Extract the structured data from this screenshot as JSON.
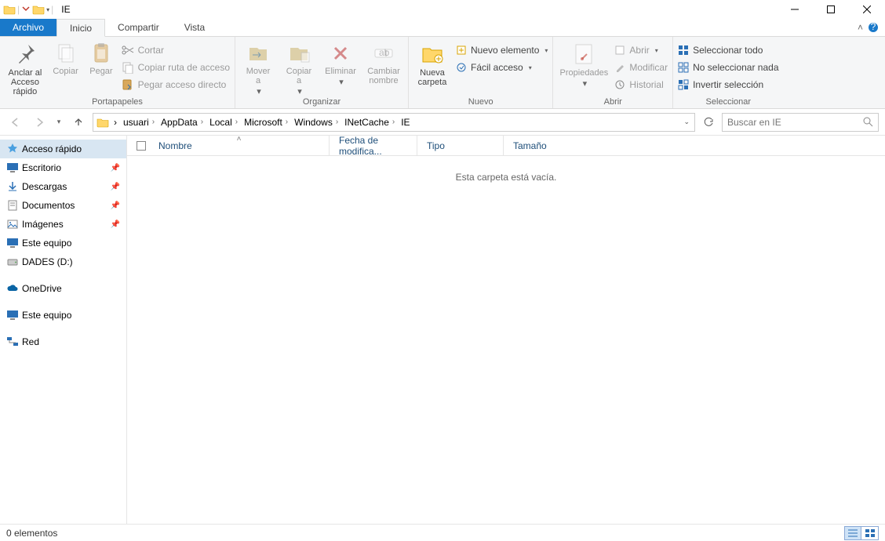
{
  "window": {
    "title": "IE"
  },
  "tabs": {
    "file": "Archivo",
    "home": "Inicio",
    "share": "Compartir",
    "view": "Vista"
  },
  "ribbon": {
    "clipboard": {
      "label": "Portapapeles",
      "pin": "Anclar al\nAcceso rápido",
      "copy": "Copiar",
      "paste": "Pegar",
      "cut": "Cortar",
      "copypath": "Copiar ruta de acceso",
      "pasteshortcut": "Pegar acceso directo"
    },
    "organize": {
      "label": "Organizar",
      "move": "Mover\na",
      "copyto": "Copiar\na",
      "delete": "Eliminar",
      "rename": "Cambiar\nnombre"
    },
    "new": {
      "label": "Nuevo",
      "newfolder": "Nueva\ncarpeta",
      "newitem": "Nuevo elemento",
      "easyaccess": "Fácil acceso"
    },
    "open": {
      "label": "Abrir",
      "properties": "Propiedades",
      "open": "Abrir",
      "edit": "Modificar",
      "history": "Historial"
    },
    "select": {
      "label": "Seleccionar",
      "selectall": "Seleccionar todo",
      "selectnone": "No seleccionar nada",
      "invert": "Invertir selección"
    }
  },
  "breadcrumbs": [
    "usuari",
    "AppData",
    "Local",
    "Microsoft",
    "Windows",
    "INetCache",
    "IE"
  ],
  "search": {
    "placeholder": "Buscar en IE"
  },
  "columns": {
    "name": "Nombre",
    "date": "Fecha de modifica...",
    "type": "Tipo",
    "size": "Tamaño"
  },
  "empty_text": "Esta carpeta está vacía.",
  "sidebar": {
    "quick": "Acceso rápido",
    "desktop": "Escritorio",
    "downloads": "Descargas",
    "documents": "Documentos",
    "images": "Imágenes",
    "thispc": "Este equipo",
    "dades": "DADES (D:)",
    "onedrive": "OneDrive",
    "thispc2": "Este equipo",
    "network": "Red"
  },
  "status": {
    "count": "0 elementos"
  }
}
